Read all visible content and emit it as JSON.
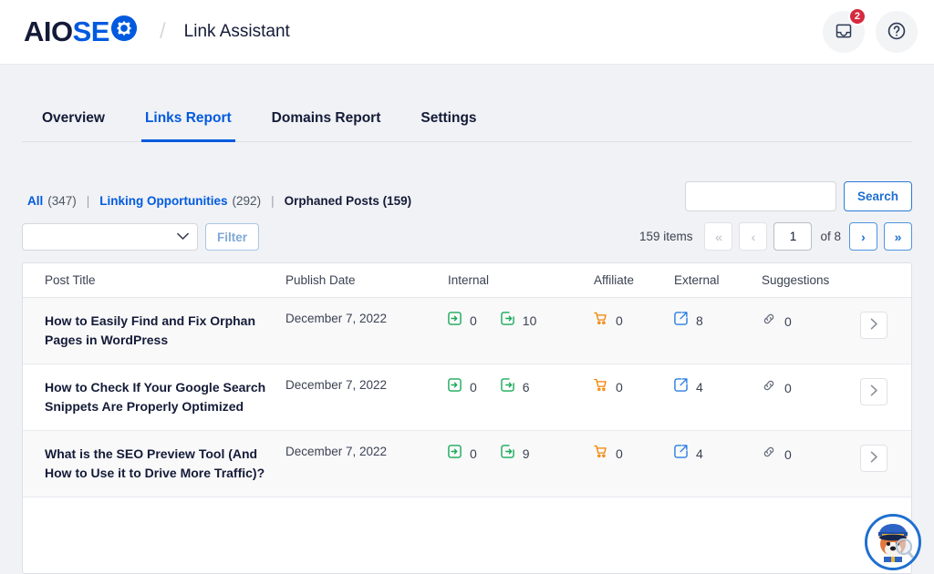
{
  "header": {
    "logo_aio": "AIO",
    "logo_seo": "SE",
    "logo_gear_icon": "gear-icon",
    "separator": "/",
    "page_title": "Link Assistant",
    "notifications_icon": "inbox-icon",
    "notifications_badge": "2",
    "help_icon": "question-mark-icon"
  },
  "tabs": [
    {
      "label": "Overview",
      "active": false
    },
    {
      "label": "Links Report",
      "active": true
    },
    {
      "label": "Domains Report",
      "active": false
    },
    {
      "label": "Settings",
      "active": false
    }
  ],
  "filters": {
    "all_label": "All",
    "all_count": "(347)",
    "sep1": "|",
    "opportunities_label": "Linking Opportunities",
    "opportunities_count": "(292)",
    "sep2": "|",
    "orphaned_label": "Orphaned Posts (159)"
  },
  "search": {
    "value": "",
    "placeholder": "",
    "button_label": "Search"
  },
  "toolbar": {
    "select_value": "",
    "select_chevron_icon": "chevron-down-icon",
    "filter_label": "Filter"
  },
  "pagination": {
    "items_text": "159 items",
    "first_label": "«",
    "prev_label": "‹",
    "page_value": "1",
    "of_text": "of 8",
    "next_label": "›",
    "last_label": "»"
  },
  "table": {
    "columns": {
      "post_title": "Post Title",
      "publish_date": "Publish Date",
      "internal": "Internal",
      "affiliate": "Affiliate",
      "external": "External",
      "suggestions": "Suggestions"
    },
    "rows": [
      {
        "title": "How to Easily Find and Fix Orphan Pages in WordPress",
        "date": "December 7, 2022",
        "internal_in": "0",
        "internal_out": "10",
        "affiliate": "0",
        "external": "8",
        "suggestions": "0",
        "action_icon": "chevron-right-icon"
      },
      {
        "title": "How to Check If Your Google Search Snippets Are Properly Optimized",
        "date": "December 7, 2022",
        "internal_in": "0",
        "internal_out": "6",
        "affiliate": "0",
        "external": "4",
        "suggestions": "0",
        "action_icon": "chevron-right-icon"
      },
      {
        "title": "What is the SEO Preview Tool (And How to Use it to Drive More Traffic)?",
        "date": "December 7, 2022",
        "internal_in": "0",
        "internal_out": "9",
        "affiliate": "0",
        "external": "4",
        "suggestions": "0",
        "action_icon": "chevron-right-icon"
      }
    ]
  },
  "support": {
    "mascot_icon": "detective-dog-mascot-icon"
  },
  "colors": {
    "brand_blue": "#005ae0",
    "text_dark": "#141b38",
    "badge_red": "#d6293e",
    "green": "#18a957",
    "orange": "#f18200",
    "page_bg": "#f1f2f5"
  }
}
